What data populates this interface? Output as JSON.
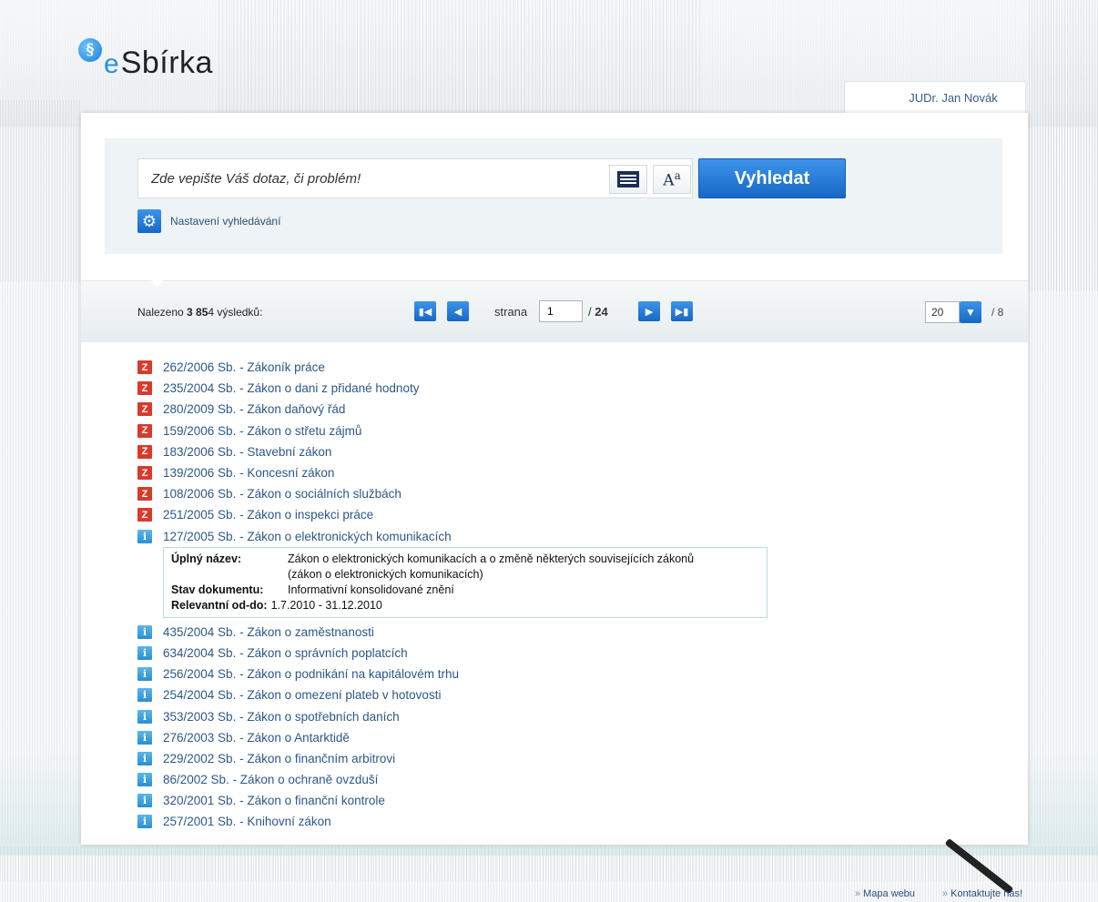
{
  "logo": {
    "mark": "§",
    "e": "e",
    "text": "Sbírka"
  },
  "user": {
    "name": "JUDr. Jan Novák"
  },
  "search": {
    "placeholder": "Zde vepište Váš dotaz, či problém!",
    "button_label": "Vyhledat",
    "docs_icon": "document-list-icon",
    "font_icon_label": "A",
    "font_icon_sup": "a",
    "settings_label": "Nastavení vyhledávání"
  },
  "results_bar": {
    "found_prefix": "Nalezeno",
    "found_count": "3 85",
    "found_suffix": "4 výsledků:",
    "page_label": "strana",
    "page_current": "1",
    "page_total_prefix": "/",
    "page_total": "24",
    "per_page": "20",
    "per_page_total": "/ 8"
  },
  "results": [
    {
      "badge": "Z",
      "type": "z",
      "text": "262/2006 Sb. - Zákoník práce"
    },
    {
      "badge": "Z",
      "type": "z",
      "text": "235/2004 Sb. - Zákon o dani z přidané hodnoty"
    },
    {
      "badge": "Z",
      "type": "z",
      "text": "280/2009 Sb. - Zákon daňový řád"
    },
    {
      "badge": "Z",
      "type": "z",
      "text": "159/2006 Sb. - Zákon o střetu zájmů"
    },
    {
      "badge": "Z",
      "type": "z",
      "text": "183/2006 Sb. - Stavební zákon"
    },
    {
      "badge": "Z",
      "type": "z",
      "text": "139/2006 Sb. - Koncesní zákon"
    },
    {
      "badge": "Z",
      "type": "z",
      "text": "108/2006 Sb. - Zákon o sociálních službách"
    },
    {
      "badge": "Z",
      "type": "z",
      "text": "251/2005 Sb. - Zákon o inspekci práce"
    },
    {
      "badge": "i",
      "type": "i",
      "text": "127/2005 Sb. - Zákon o elektronických komunikacích"
    }
  ],
  "detail": {
    "full_name_label": "Úplný název:",
    "full_name_line1": "Zákon o elektronických komunikacích a o změně některých souvisejících zákonů",
    "full_name_line2": "(zákon o elektronických komunikacích)",
    "status_label": "Stav dokumentu:",
    "status_value": "Informativní konsolidované znění",
    "relevant_label": "Relevantní od-do:",
    "relevant_value": "1.7.2010 - 31.12.2010"
  },
  "results_after": [
    {
      "badge": "i",
      "type": "i",
      "text": "435/2004 Sb. - Zákon o zaměstnanosti"
    },
    {
      "badge": "i",
      "type": "i",
      "text": "634/2004 Sb. - Zákon o správních poplatcích"
    },
    {
      "badge": "i",
      "type": "i",
      "text": "256/2004 Sb. - Zákon o podnikání na kapitálovém trhu"
    },
    {
      "badge": "i",
      "type": "i",
      "text": "254/2004 Sb. - Zákon o omezení plateb v hotovosti"
    },
    {
      "badge": "i",
      "type": "i",
      "text": "353/2003 Sb. - Zákon o spotřebních daních"
    },
    {
      "badge": "i",
      "type": "i",
      "text": "276/2003 Sb. - Zákon o Antarktidě"
    },
    {
      "badge": "i",
      "type": "i",
      "text": "229/2002 Sb. - Zákon o finančním arbitrovi"
    },
    {
      "badge": "i",
      "type": "i",
      "text": "86/2002 Sb. - Zákon o ochraně ovzduší"
    },
    {
      "badge": "i",
      "type": "i",
      "text": "320/2001 Sb. - Zákon o finanční kontrole"
    },
    {
      "badge": "i",
      "type": "i",
      "text": "257/2001 Sb. - Knihovní zákon"
    }
  ],
  "footer": {
    "sitemap": "Mapa webu",
    "contact": "Kontaktujte nás!"
  },
  "colors": {
    "accent": "#1e78d6",
    "link": "#2d5886",
    "badge_z": "#d83a2c",
    "badge_i": "#3ea3e0"
  }
}
